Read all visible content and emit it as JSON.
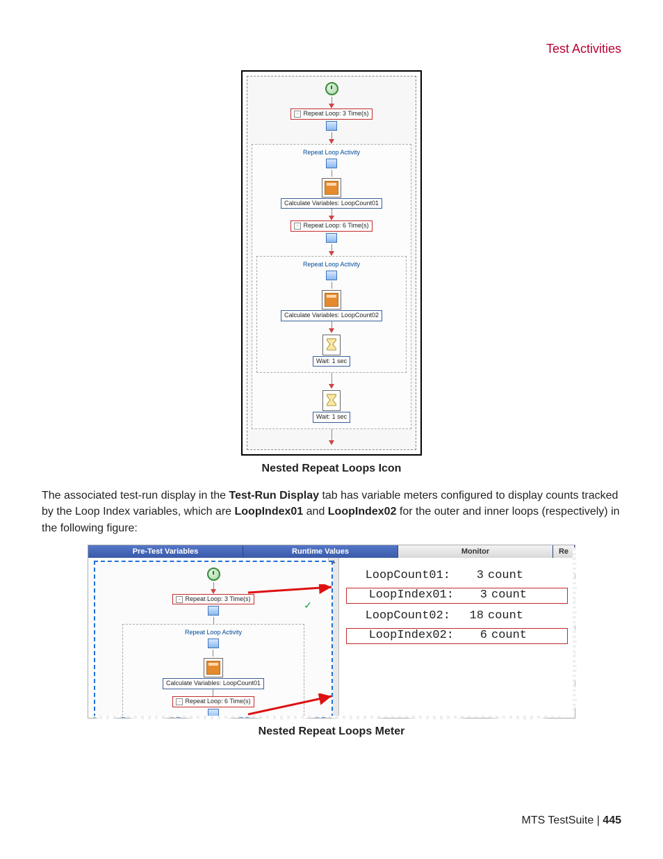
{
  "header": {
    "section": "Test Activities"
  },
  "figure1": {
    "repeat1_label": "Repeat Loop: 3 Time(s)",
    "activity_label": "Repeat Loop Activity",
    "calc1_label": "Calculate Variables: LoopCount01",
    "repeat2_label": "Repeat Loop: 6 Time(s)",
    "calc2_label": "Calculate Variables: LoopCount02",
    "wait1_label": "Wait: 1 sec",
    "wait2_label": "Wait: 1 sec",
    "caption": "Nested Repeat Loops Icon"
  },
  "paragraph": {
    "t1": "The associated test-run display in the ",
    "b1": "Test-Run Display",
    "t2": " tab has variable meters configured to display counts tracked by the Loop Index variables, which are ",
    "b2": "LoopIndex01",
    "t3": " and ",
    "b3": "LoopIndex02",
    "t4": " for the outer and inner loops (respectively) in the following figure:"
  },
  "figure2": {
    "tabs": {
      "t1": "Pre-Test Variables",
      "t2": "Runtime Values",
      "t3": "Monitor",
      "t4": "Re"
    },
    "left": {
      "repeat1": "Repeat Loop: 3 Time(s)",
      "activity": "Repeat Loop Activity",
      "calc1": "Calculate Variables: LoopCount01",
      "repeat2": "Repeat Loop: 6 Time(s)"
    },
    "meters": [
      {
        "label": "LoopCount01:",
        "value": "3",
        "unit": "count",
        "boxed": false
      },
      {
        "label": "LoopIndex01:",
        "value": "3",
        "unit": "count",
        "boxed": true
      },
      {
        "label": "LoopCount02:",
        "value": "18",
        "unit": "count",
        "boxed": false
      },
      {
        "label": "LoopIndex02:",
        "value": "6",
        "unit": "count",
        "boxed": true
      }
    ],
    "caption": "Nested Repeat Loops Meter"
  },
  "footer": {
    "product": "MTS TestSuite",
    "sep": " | ",
    "page": "445"
  }
}
